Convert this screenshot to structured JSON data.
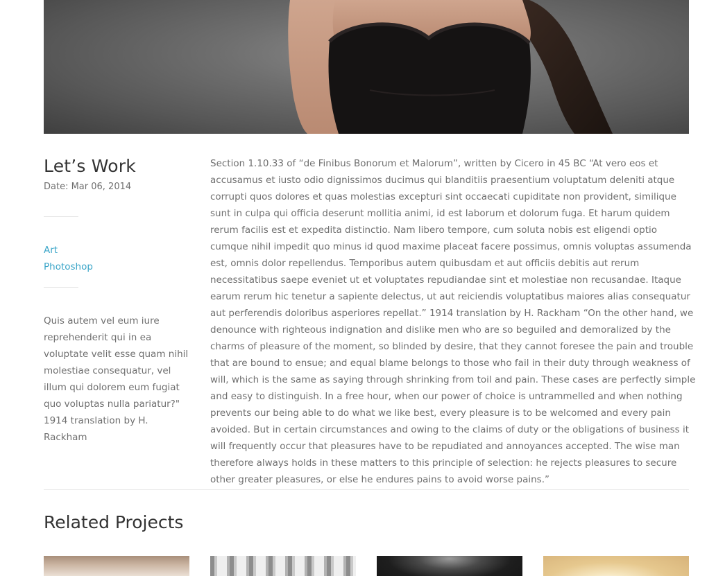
{
  "project": {
    "title": "Let’s Work",
    "date": "Date: Mar 06, 2014",
    "tags": [
      "Art",
      "Photoshop"
    ],
    "side_quote": "Quis autem vel eum iure reprehenderit qui in ea voluptate velit esse quam nihil molestiae consequatur, vel illum qui dolorem eum fugiat quo voluptas nulla pariatur?\" 1914 translation by H. Rackham",
    "body": "Section 1.10.33 of “de Finibus Bonorum et Malorum”, written by Cicero in 45 BC “At vero eos et accusamus et iusto odio dignissimos ducimus qui blanditiis praesentium voluptatum deleniti atque corrupti quos dolores et quas molestias excepturi sint occaecati cupiditate non provident, similique sunt in culpa qui officia deserunt mollitia animi, id est laborum et dolorum fuga. Et harum quidem rerum facilis est et expedita distinctio. Nam libero tempore, cum soluta nobis est eligendi optio cumque nihil impedit quo minus id quod maxime placeat facere possimus, omnis voluptas assumenda est, omnis dolor repellendus. Temporibus autem quibusdam et aut officiis debitis aut rerum necessitatibus saepe eveniet ut et voluptates repudiandae sint et molestiae non recusandae. Itaque earum rerum hic tenetur a sapiente delectus, ut aut reiciendis voluptatibus maiores alias consequatur aut perferendis doloribus asperiores repellat.” 1914 translation by H. Rackham “On the other hand, we denounce with righteous indignation and dislike men who are so beguiled and demoralized by the charms of pleasure of the moment, so blinded by desire, that they cannot foresee the pain and trouble that are bound to ensue; and equal blame belongs to those who fail in their duty through weakness of will, which is the same as saying through shrinking from toil and pain. These cases are perfectly simple and easy to distinguish. In a free hour, when our power of choice is untrammelled and when nothing prevents our being able to do what we like best, every pleasure is to be welcomed and every pain avoided. But in certain circumstances and owing to the claims of duty or the obligations of business it will frequently occur that pleasures have to be repudiated and annoyances accepted. The wise man therefore always holds in these matters to this principle of selection: he rejects pleasures to secure other greater pleasures, or else he endures pains to avoid worse pains.”"
  },
  "related": {
    "heading": "Related Projects",
    "thumbnails": [
      "interior-room-photo",
      "bookshelf-interior-photo",
      "dark-portrait-photo",
      "sunset-beach-photo"
    ]
  },
  "colors": {
    "heading": "#333333",
    "text": "#6f6f6f",
    "accent_link": "#3aa5c8",
    "divider": "#e8e8e8",
    "background": "#ffffff"
  }
}
